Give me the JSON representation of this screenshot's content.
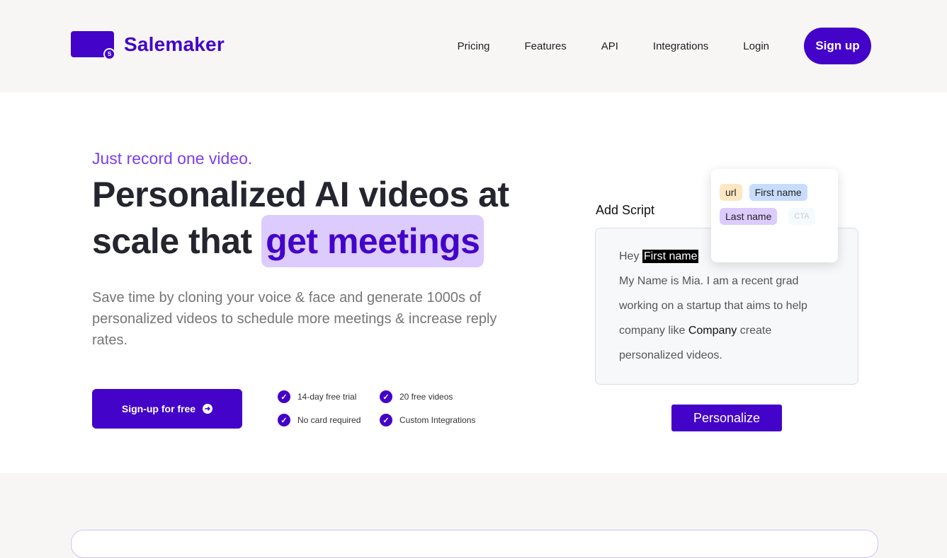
{
  "header": {
    "brand": "Salemaker",
    "logo_badge": "S",
    "nav": [
      {
        "label": "Pricing"
      },
      {
        "label": "Features"
      },
      {
        "label": "API"
      },
      {
        "label": "Integrations"
      },
      {
        "label": "Login"
      }
    ],
    "signup_label": "Sign up"
  },
  "hero": {
    "tagline": "Just record one video.",
    "headline_line1": "Personalized AI videos at",
    "headline_line2": "scale that",
    "headline_highlight": "get meetings",
    "subtext": "Save time by cloning your voice & face and generate 1000s of personalized videos to schedule more meetings & increase reply rates.",
    "cta_label": "Sign-up for free",
    "cta_icon": "arrow-right-circle-icon",
    "features": [
      {
        "label": "14-day free trial"
      },
      {
        "label": "20 free videos"
      },
      {
        "label": "No card required"
      },
      {
        "label": "Custom Integrations"
      }
    ]
  },
  "script": {
    "label": "Add Script",
    "greeting": "Hey",
    "first_name_var": "First name",
    "body_part1": "My Name is Mia. I am a recent grad working on a startup that aims to help company like",
    "company_var": "Company",
    "body_part2": "create personalized videos.",
    "variables": [
      {
        "label": "url"
      },
      {
        "label": "First name"
      },
      {
        "label": "Last name"
      },
      {
        "label": "CTA"
      }
    ],
    "personalize_label": "Personalize"
  },
  "colors": {
    "brand": "#4303c9",
    "tagline": "#7a3ff0",
    "highlight_bg": "#dccbfd"
  }
}
